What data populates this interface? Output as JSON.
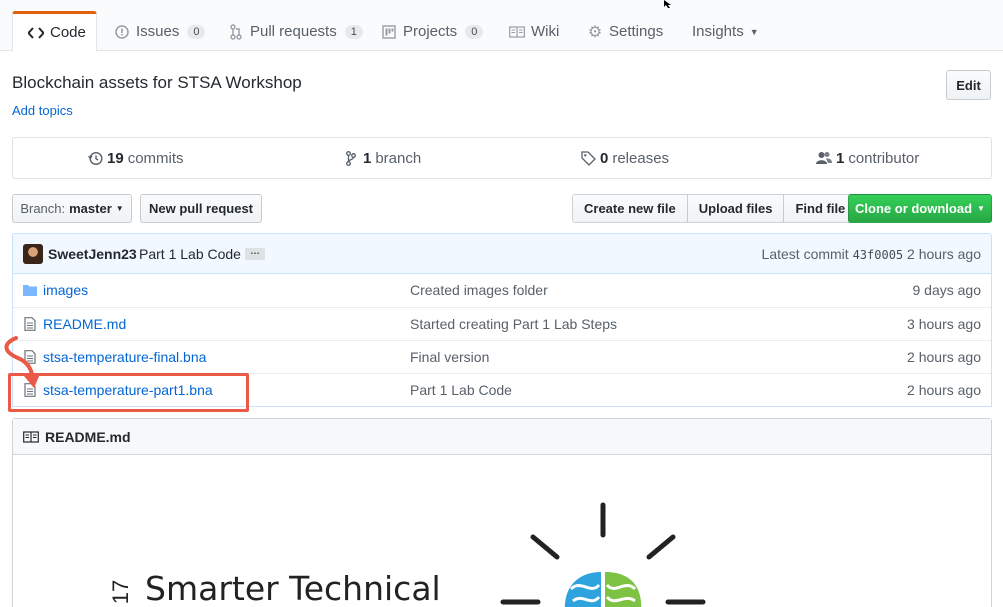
{
  "tabs": [
    {
      "label": "Code",
      "icon": "code-icon",
      "active": true
    },
    {
      "label": "Issues",
      "icon": "issue-icon",
      "count": "0"
    },
    {
      "label": "Pull requests",
      "icon": "pull-request-icon",
      "count": "1"
    },
    {
      "label": "Projects",
      "icon": "project-icon",
      "count": "0"
    },
    {
      "label": "Wiki",
      "icon": "book-icon"
    },
    {
      "label": "Settings",
      "icon": "gear-icon"
    },
    {
      "label": "Insights",
      "icon": "graph-icon"
    }
  ],
  "repo": {
    "description": "Blockchain assets for STSA Workshop",
    "add_topics": "Add topics",
    "edit_label": "Edit"
  },
  "summary": {
    "commits_count": "19",
    "commits_label": "commits",
    "branches_count": "1",
    "branches_label": "branch",
    "releases_count": "0",
    "releases_label": "releases",
    "contributors_count": "1",
    "contributors_label": "contributor"
  },
  "toolbar": {
    "branch_prefix": "Branch:",
    "branch_name": "master",
    "new_pull_request": "New pull request",
    "create_new_file": "Create new file",
    "upload_files": "Upload files",
    "find_file": "Find file",
    "clone_or_download": "Clone or download"
  },
  "latest_commit": {
    "author": "SweetJenn23",
    "message": "Part 1 Lab Code",
    "ellipsis": "…",
    "latest_label": "Latest commit",
    "sha": "43f0005",
    "age": "2 hours ago"
  },
  "files": [
    {
      "name": "images",
      "type": "folder",
      "message": "Created images folder",
      "age": "9 days ago"
    },
    {
      "name": "README.md",
      "type": "file",
      "message": "Started creating Part 1 Lab Steps",
      "age": "3 hours ago"
    },
    {
      "name": "stsa-temperature-final.bna",
      "type": "file",
      "message": "Final version",
      "age": "2 hours ago"
    },
    {
      "name": "stsa-temperature-part1.bna",
      "type": "file",
      "message": "Part 1 Lab Code",
      "age": "2 hours ago"
    }
  ],
  "readme": {
    "title": "README.md",
    "logo_text": "Smarter Technical",
    "logo_year": "17"
  },
  "colors": {
    "link": "#0366d6",
    "active_tab_border": "#e36209",
    "clone_green": "#28a745",
    "highlight_red": "#ea5a47"
  }
}
